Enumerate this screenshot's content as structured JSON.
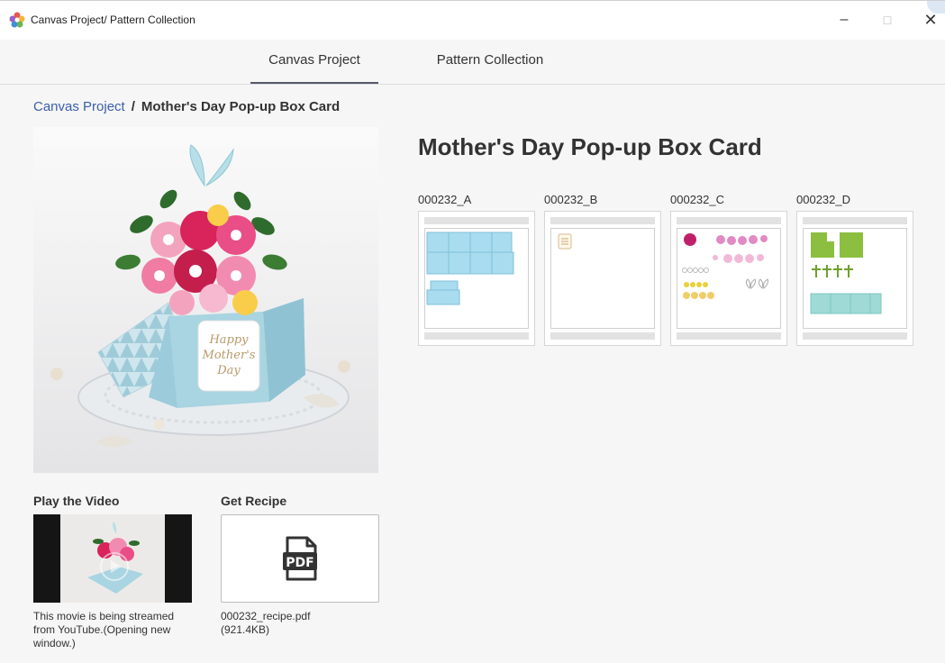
{
  "window": {
    "title": "Canvas Project/ Pattern Collection"
  },
  "tabs": [
    {
      "label": "Canvas Project",
      "active": true
    },
    {
      "label": "Pattern Collection",
      "active": false
    }
  ],
  "breadcrumb": {
    "parent": "Canvas Project",
    "separator": "/",
    "current": "Mother's Day Pop-up Box Card"
  },
  "project": {
    "title": "Mother's Day Pop-up Box Card",
    "hero_text": [
      "Happy",
      "Mother's",
      "Day"
    ]
  },
  "patterns": [
    {
      "code": "000232_A"
    },
    {
      "code": "000232_B"
    },
    {
      "code": "000232_C"
    },
    {
      "code": "000232_D"
    }
  ],
  "video": {
    "heading": "Play the Video",
    "caption": "This movie is being streamed from YouTube.(Opening new window.)"
  },
  "recipe": {
    "heading": "Get Recipe",
    "icon_label": "PDF",
    "filename": "000232_recipe.pdf",
    "size": "(921.4KB)"
  },
  "colors": {
    "link": "#3a5fa8",
    "tab_underline": "#555a6b",
    "pattern_blue": "#a9dcef",
    "pattern_green": "#8cbf3f",
    "pattern_pink": "#e28ac4"
  }
}
